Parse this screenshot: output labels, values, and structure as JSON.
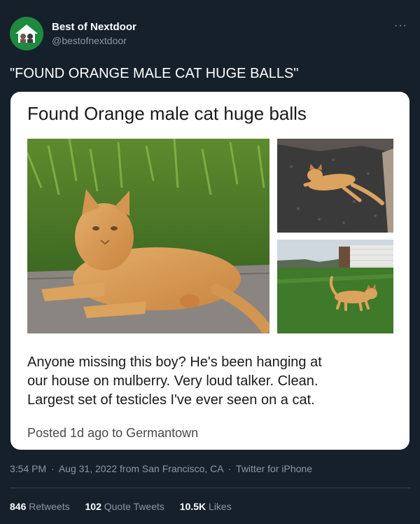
{
  "header": {
    "display_name": "Best of Nextdoor",
    "handle": "@bestofnextdoor",
    "more_icon": "···"
  },
  "tweet": {
    "text": "\"FOUND ORANGE MALE CAT HUGE BALLS\""
  },
  "card": {
    "title": "Found Orange male cat huge balls",
    "body_lines": [
      "Anyone missing this boy? He's been hanging at",
      "our house on mulberry. Very loud talker. Clean.",
      "Largest set of testicles I've ever seen on a cat."
    ],
    "footer": "Posted 1d ago to Germantown",
    "photos": [
      {
        "name": "photo-cat-lying-on-grass"
      },
      {
        "name": "photo-cat-on-gravel"
      },
      {
        "name": "photo-cat-in-yard"
      }
    ]
  },
  "meta": {
    "time": "3:54 PM",
    "date": "Aug 31, 2022",
    "location": "from San Francisco, CA",
    "source": "Twitter for iPhone",
    "separator": "·"
  },
  "stats": {
    "retweets_count": "846",
    "retweets_label": "Retweets",
    "quotes_count": "102",
    "quotes_label": "Quote Tweets",
    "likes_count": "10.5K",
    "likes_label": "Likes"
  },
  "colors": {
    "background": "#15202b",
    "secondary_text": "#8b98a5",
    "avatar_green": "#1f8a3d"
  }
}
